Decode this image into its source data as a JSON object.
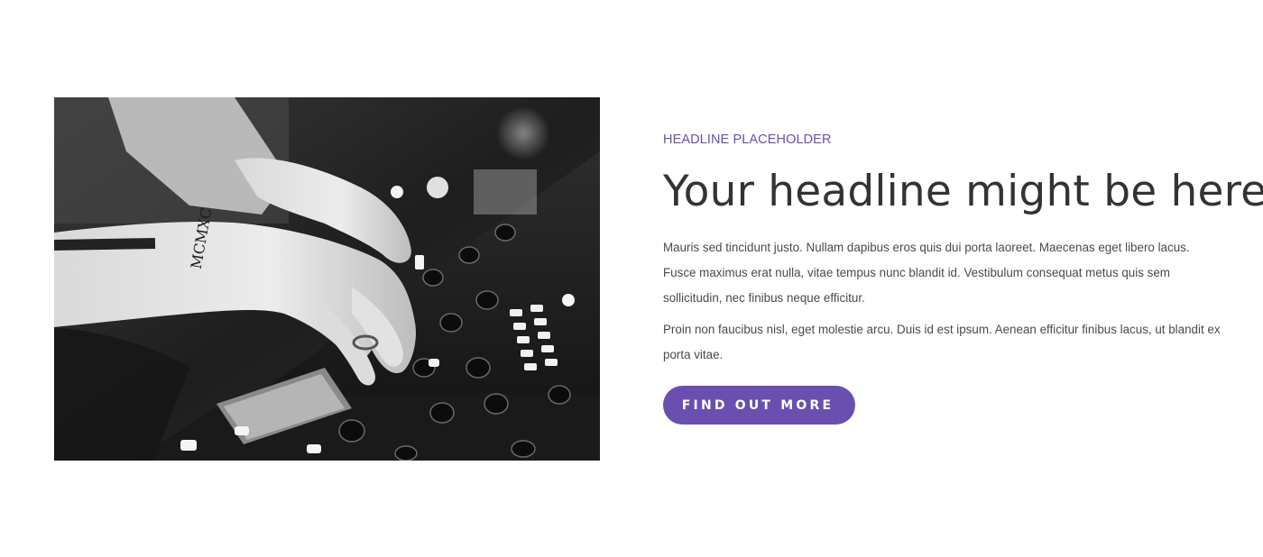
{
  "image": {
    "alt_icon": "dj-mixer-photo",
    "tattoo_text": "MCMXC"
  },
  "content": {
    "eyebrow": "HEADLINE PLACEHOLDER",
    "headline": "Your headline might be here",
    "paragraph_1": "Mauris sed tincidunt justo. Nullam dapibus eros quis dui porta laoreet. Maecenas eget libero lacus. Fusce maximus erat nulla, vitae tempus nunc blandit id. Vestibulum consequat metus quis sem sollicitudin, nec finibus neque efficitur.",
    "paragraph_2": "Proin non faucibus nisl, eget molestie arcu. Duis id est ipsum. Aenean efficitur finibus lacus, ut blandit ex porta vitae.",
    "button_label": "FIND OUT MORE"
  },
  "colors": {
    "accent": "#6a4fb0",
    "heading": "#333333",
    "body_text": "#4a4a4a",
    "background": "#ffffff"
  }
}
